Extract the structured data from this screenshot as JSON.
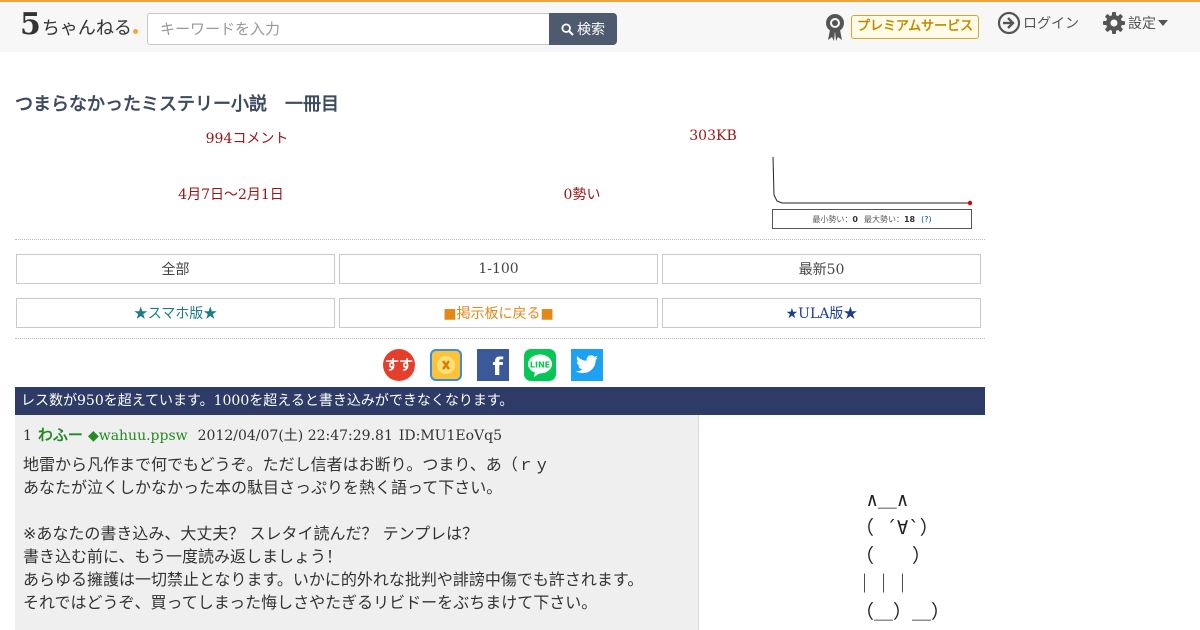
{
  "header": {
    "logo_five": "5",
    "logo_text": "ちゃんねる",
    "search_placeholder": "キーワードを入力",
    "search_button": "検索",
    "premium_label": "プレミアムサービス",
    "login_label": "ログイン",
    "settings_label": "設定",
    "icons": {
      "search": "magnifier-icon",
      "premium": "ribbon-medal-icon",
      "login": "login-arrow-icon",
      "settings": "gear-icon",
      "dropdown": "caret-down-icon"
    }
  },
  "thread": {
    "title": "つまらなかったミステリー小説　一冊目",
    "comments": "994コメント",
    "size": "303KB",
    "period": "4月7日〜2月1日",
    "momentum": "0勢い",
    "graph": {
      "min_label": "最小勢い：",
      "min_value": "0",
      "max_label": "最大勢い：",
      "max_value": "18",
      "help": "(?)"
    }
  },
  "nav": {
    "all": "全部",
    "range": "1-100",
    "latest": "最新50",
    "smartphone": "★スマホ版★",
    "back_board": "■掲示板に戻る■",
    "ula": "★ULA版★"
  },
  "share": {
    "sssp_label": "すす",
    "icons": [
      "sssp-icon",
      "hatena-icon",
      "facebook-icon",
      "line-icon",
      "twitter-icon"
    ]
  },
  "notice": "レス数が950を超えています。1000を超えると書き込みができなくなります。",
  "post": {
    "number": "1",
    "name": "わふー",
    "trip": "◆wahuu.ppsw",
    "date": "2012/04/07(土) 22:47:29.81",
    "id": "ID:MU1EoVq5",
    "body": "地雷から凡作まで何でもどうぞ。ただし信者はお断り。つまり、あ（ｒｙ\nあなたが泣くしかなかった本の駄目さっぷりを熱く語って下さい。\n\n※あなたの書き込み、大丈夫？ スレタイ読んだ？ テンプレは？\n書き込む前に、もう一度読み返しましょう！\nあらゆる擁護は一切禁止となります。いかに的外れな批判や誹謗中傷でも許されます。\nそれではどうぞ、買ってしまった悔しさやたぎるリビドーをぶちまけて下さい。"
  },
  "ascii_art": " ∧＿∧\n（ ´∀`）\n（　　）\n｜｜｜\n（＿）＿）",
  "colors": {
    "accent_orange": "#f0a53a",
    "stat_red": "#9a1515",
    "notice_bg": "#2d3b66",
    "name_green": "#228b22",
    "search_btn": "#4e5a6e"
  }
}
